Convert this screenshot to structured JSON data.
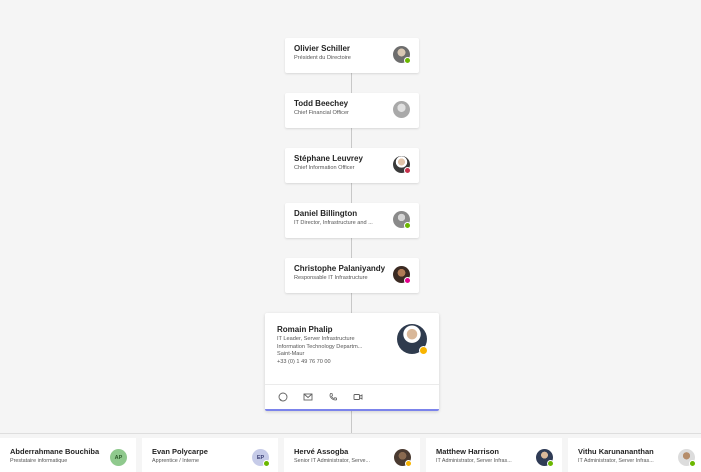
{
  "chain": [
    {
      "name": "Olivier Schiller",
      "title": "Président du Directoire",
      "presence": "#6bb700"
    },
    {
      "name": "Todd Beechey",
      "title": "Chief Financial Officer",
      "presence": ""
    },
    {
      "name": "Stéphane Leuvrey",
      "title": "Chief Information Officer",
      "presence": "#c4314b"
    },
    {
      "name": "Daniel Billington",
      "title": "IT Director, Infrastructure and ...",
      "presence": "#6bb700"
    },
    {
      "name": "Christophe Palaniyandy",
      "title": "Responsable IT Infrastructure",
      "presence": "#e3008c"
    }
  ],
  "selected": {
    "name": "Romain Phalip",
    "title": "IT Leader, Server Infrastructure",
    "department": "Information Technology Departm...",
    "office": "Saint-Maur",
    "phone": "+33 (0) 1 49 76 70 00",
    "presence": "#f8b400",
    "actions": [
      "chat",
      "email",
      "call",
      "video"
    ]
  },
  "reports": [
    {
      "name": "Abderrahmane Bouchiba",
      "title": "Prestataire informatique",
      "initials": "AP",
      "initials_color": "#8fc98d"
    },
    {
      "name": "Evan Polycarpe",
      "title": "Apprentice / Interne",
      "initials": "EP",
      "initials_color": "#c6cbe8"
    },
    {
      "name": "Hervé Assogba",
      "title": "Senior IT Administrator, Serve...",
      "initials": "",
      "initials_color": ""
    },
    {
      "name": "Matthew Harrison",
      "title": "IT Administrator, Server Infras...",
      "initials": "",
      "initials_color": ""
    },
    {
      "name": "Vithu Karunananthan",
      "title": "IT Administrator, Server Infras...",
      "initials": "",
      "initials_color": ""
    }
  ]
}
